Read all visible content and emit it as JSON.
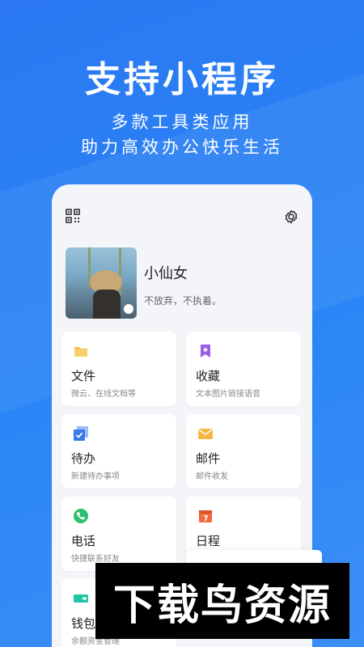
{
  "headline": "支持小程序",
  "subtitle_line1": "多款工具类应用",
  "subtitle_line2": "助力高效办公快乐生活",
  "profile": {
    "name": "小仙女",
    "motto": "不放弃，不执着。"
  },
  "cards": [
    {
      "icon": "folder-icon",
      "title": "文件",
      "desc": "微云、在线文档等"
    },
    {
      "icon": "bookmark-icon",
      "title": "收藏",
      "desc": "文本图片链接语音"
    },
    {
      "icon": "todo-icon",
      "title": "待办",
      "desc": "新建待办事项"
    },
    {
      "icon": "mail-icon",
      "title": "邮件",
      "desc": "邮件收发"
    },
    {
      "icon": "phone-icon",
      "title": "电话",
      "desc": "快捷联系好友"
    },
    {
      "icon": "calendar-icon",
      "title": "日程",
      "desc": ""
    },
    {
      "icon": "wallet-icon",
      "title": "钱包",
      "desc": "余额资金管理"
    }
  ],
  "watermark": "下载鸟资源",
  "colors": {
    "background": "#2b7cf3",
    "folder": "#f6c24e",
    "bookmark": "#9b5de5",
    "todo": "#3b7be8",
    "mail": "#f5b841",
    "phone": "#2fbf71",
    "calendar": "#f26a3c",
    "wallet": "#1fc7a3"
  }
}
